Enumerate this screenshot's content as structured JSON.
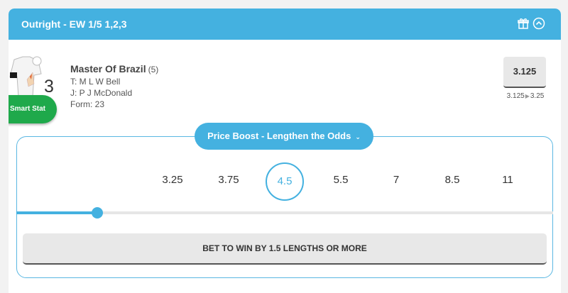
{
  "header": {
    "title": "Outright - EW 1/5 1,2,3"
  },
  "runner": {
    "cloth_number": "3",
    "name": "Master Of Brazil",
    "draw": "(5)",
    "trainer": "T: M L W Bell",
    "jockey": "J: P J McDonald",
    "form": "Form: 23"
  },
  "smart_stat": {
    "label": "Smart Stat"
  },
  "price": {
    "current": "3.125",
    "previous": "3.125",
    "new": "3.25"
  },
  "boost": {
    "label": "Price Boost - Lengthen the Odds",
    "odds": [
      "3.25",
      "3.75",
      "4.5",
      "5.5",
      "7",
      "8.5",
      "11"
    ],
    "selected_index": 2,
    "slider_fraction": 0.15,
    "bet_label": "BET TO WIN BY 1.5 LENGTHS OR MORE"
  },
  "colors": {
    "accent": "#44b1e0",
    "smart_stat": "#1fa94b"
  },
  "icons": [
    "silk-icon",
    "gift-icon",
    "chevron-up-circle-icon",
    "chevron-down-icon",
    "play-arrow-icon"
  ]
}
